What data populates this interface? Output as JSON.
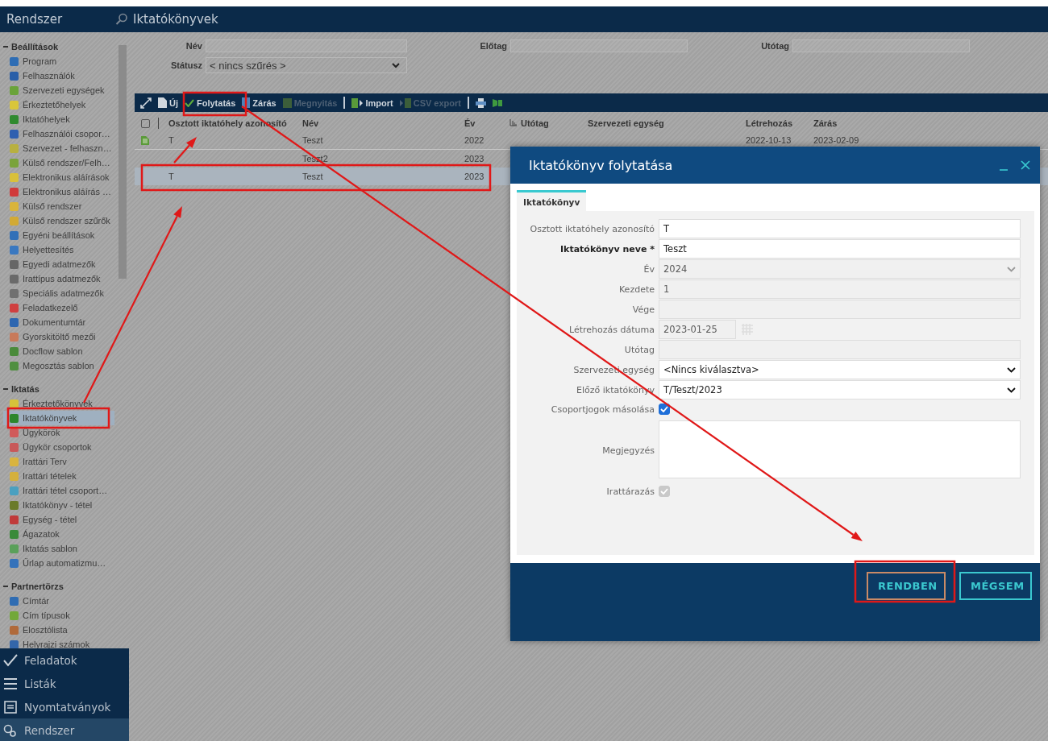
{
  "header": {
    "app_title": "Rendszer",
    "page_title": "Iktatókönyvek"
  },
  "sidebar": {
    "sections": [
      {
        "title": "Beállítások",
        "expanded": true,
        "items": [
          {
            "label": "Program",
            "color": "#2e6db4",
            "selected": false
          },
          {
            "label": "Felhasználók",
            "color": "#2a5fa8",
            "selected": false
          },
          {
            "label": "Szervezeti egységek",
            "color": "#6aa33a",
            "selected": false
          },
          {
            "label": "Érkeztetőhelyek",
            "color": "#d9c63a",
            "selected": false
          },
          {
            "label": "Iktatóhelyek",
            "color": "#2f8a2f",
            "selected": false
          },
          {
            "label": "Felhasználói csopor…",
            "color": "#2e5fb0",
            "selected": false
          },
          {
            "label": "Szervezet - felhaszn…",
            "color": "#b8b040",
            "selected": false
          },
          {
            "label": "Külső rendszer/Felh…",
            "color": "#7aa33a",
            "selected": false
          },
          {
            "label": "Elektronikus aláírások",
            "color": "#d9c03a",
            "selected": false
          },
          {
            "label": "Elektronikus aláírás …",
            "color": "#d03a3a",
            "selected": false
          },
          {
            "label": "Külső rendszer",
            "color": "#d9b43a",
            "selected": false
          },
          {
            "label": "Külső rendszer szűrők",
            "color": "#d2aa34",
            "selected": false
          },
          {
            "label": "Egyéni beállítások",
            "color": "#3170b8",
            "selected": false
          },
          {
            "label": "Helyettesítés",
            "color": "#3a78c0",
            "selected": false
          },
          {
            "label": "Egyedi adatmezők",
            "color": "#666666",
            "selected": false
          },
          {
            "label": "Irattípus adatmezők",
            "color": "#6a6a6a",
            "selected": false
          },
          {
            "label": "Speciális adatmezők",
            "color": "#707070",
            "selected": false
          },
          {
            "label": "Feladatkezelő",
            "color": "#d04040",
            "selected": false
          },
          {
            "label": "Dokumentumtár",
            "color": "#2d66b0",
            "selected": false
          },
          {
            "label": "Gyorskitöltő mezői",
            "color": "#c87a5a",
            "selected": false
          },
          {
            "label": "Docflow sablon",
            "color": "#4a8a3a",
            "selected": false
          },
          {
            "label": "Megosztás sablon",
            "color": "#4f8f3f",
            "selected": false
          }
        ]
      },
      {
        "title": "Iktatás",
        "expanded": true,
        "items": [
          {
            "label": "Érkeztetőkönyvek",
            "color": "#d6c23a",
            "selected": false
          },
          {
            "label": "Iktatókönyvek",
            "color": "#2c862c",
            "selected": true
          },
          {
            "label": "Ügykörök",
            "color": "#d05a5a",
            "selected": false
          },
          {
            "label": "Ügykör csoportok",
            "color": "#c85858",
            "selected": false
          },
          {
            "label": "Irattári Terv",
            "color": "#d9b43f",
            "selected": false
          },
          {
            "label": "Irattári tételek",
            "color": "#d4b03c",
            "selected": false
          },
          {
            "label": "Irattári tétel csoport…",
            "color": "#4aa0c0",
            "selected": false
          },
          {
            "label": "Iktatókönyv - tétel",
            "color": "#6a7a2a",
            "selected": false
          },
          {
            "label": "Egység - tétel",
            "color": "#c03a3a",
            "selected": false
          },
          {
            "label": "Ágazatok",
            "color": "#3a8a3a",
            "selected": false
          },
          {
            "label": "Iktatás sablon",
            "color": "#5aa05a",
            "selected": false
          },
          {
            "label": "Űrlap automatizmu…",
            "color": "#3472ba",
            "selected": false
          }
        ]
      },
      {
        "title": "Partnertörzs",
        "expanded": true,
        "items": [
          {
            "label": "Címtár",
            "color": "#2f6cb2",
            "selected": false
          },
          {
            "label": "Cím típusok",
            "color": "#72a83a",
            "selected": false
          },
          {
            "label": "Elosztólista",
            "color": "#b06a3a",
            "selected": false
          },
          {
            "label": "Helyrajzi számok",
            "color": "#3366aa",
            "selected": false
          }
        ]
      }
    ]
  },
  "bottom_nav": [
    {
      "label": "Feladatok",
      "kind": "check",
      "selected": false
    },
    {
      "label": "Listák",
      "kind": "list",
      "selected": false
    },
    {
      "label": "Nyomtatványok",
      "kind": "form",
      "selected": false
    },
    {
      "label": "Rendszer",
      "kind": "system",
      "selected": true
    }
  ],
  "filters": [
    {
      "label": "Név",
      "kind": "text"
    },
    {
      "label": "Előtag",
      "kind": "text"
    },
    {
      "label": "Utótag",
      "kind": "text"
    },
    {
      "label": "Státusz",
      "kind": "select",
      "value": "< nincs szűrés >"
    }
  ],
  "toolbar": [
    {
      "kind": "expand",
      "disabled": false
    },
    {
      "kind": "new",
      "label": "Új",
      "disabled": false
    },
    {
      "kind": "continue",
      "label": "Folytatás",
      "disabled": false
    },
    {
      "kind": "close",
      "label": "Zárás",
      "disabled": false
    },
    {
      "kind": "open",
      "label": "Megnyitás",
      "disabled": true
    },
    {
      "kind": "separator"
    },
    {
      "kind": "import",
      "label": "Import",
      "disabled": false
    },
    {
      "kind": "export",
      "label": "CSV export",
      "disabled": true
    },
    {
      "kind": "separator"
    },
    {
      "kind": "print",
      "disabled": false
    },
    {
      "kind": "excel",
      "disabled": false
    }
  ],
  "table": {
    "select_all_checked": false,
    "columns": [
      "Osztott iktatóhely azonosító",
      "Név",
      "Év",
      "Utótag",
      "Szervezeti egység",
      "Létrehozás",
      "Zárás"
    ],
    "rows": [
      {
        "document_icon": true,
        "selected": false,
        "cells": {
          "id": "T",
          "name": "Teszt",
          "year": "2022",
          "created": "2022-10-13",
          "closed": "2023-02-09"
        }
      },
      {
        "document_icon": false,
        "selected": false,
        "cells": {
          "name": "Teszt2",
          "year": "2023"
        }
      },
      {
        "document_icon": false,
        "selected": true,
        "cells": {
          "id": "T",
          "name": "Teszt",
          "year": "2023"
        }
      }
    ]
  },
  "dialog": {
    "title": "Iktatókönyv folytatása",
    "tabs": [
      {
        "label": "Iktatókönyv",
        "selected": true
      }
    ],
    "fields": [
      {
        "kind": "text",
        "label": "Osztott iktatóhely azonosító",
        "value": "T",
        "required": false,
        "disabled": false
      },
      {
        "kind": "text",
        "label": "Iktatókönyv neve *",
        "value": "Teszt",
        "required": true,
        "disabled": false
      },
      {
        "kind": "select",
        "label": "Év",
        "value": "2024",
        "required": false,
        "disabled": true
      },
      {
        "kind": "text",
        "label": "Kezdete",
        "value": "1",
        "required": false,
        "disabled": true
      },
      {
        "kind": "text",
        "label": "Vége",
        "required": false,
        "disabled": true
      },
      {
        "kind": "date",
        "label": "Létrehozás dátuma",
        "value": "2023-01-25",
        "required": false,
        "disabled": true
      },
      {
        "kind": "text",
        "label": "Utótag",
        "required": false,
        "disabled": true
      },
      {
        "kind": "select",
        "label": "Szervezeti egység",
        "value": "<Nincs kiválasztva>",
        "required": false,
        "disabled": false
      },
      {
        "kind": "select",
        "label": "Előző iktatókönyv",
        "value": "T/Teszt/2023",
        "required": false,
        "disabled": false
      },
      {
        "kind": "checkbox",
        "label": "Csoportjogok másolása",
        "checked": true,
        "required": false,
        "disabled": false
      },
      {
        "kind": "textarea",
        "label": "Megjegyzés",
        "required": false,
        "disabled": false
      },
      {
        "kind": "checkbox",
        "label": "Irattárazás",
        "checked": true,
        "required": false,
        "disabled": true
      }
    ],
    "buttons": [
      {
        "label": "RENDBEN",
        "kind": "primary"
      },
      {
        "label": "MÉGSEM",
        "kind": "secondary"
      }
    ]
  }
}
